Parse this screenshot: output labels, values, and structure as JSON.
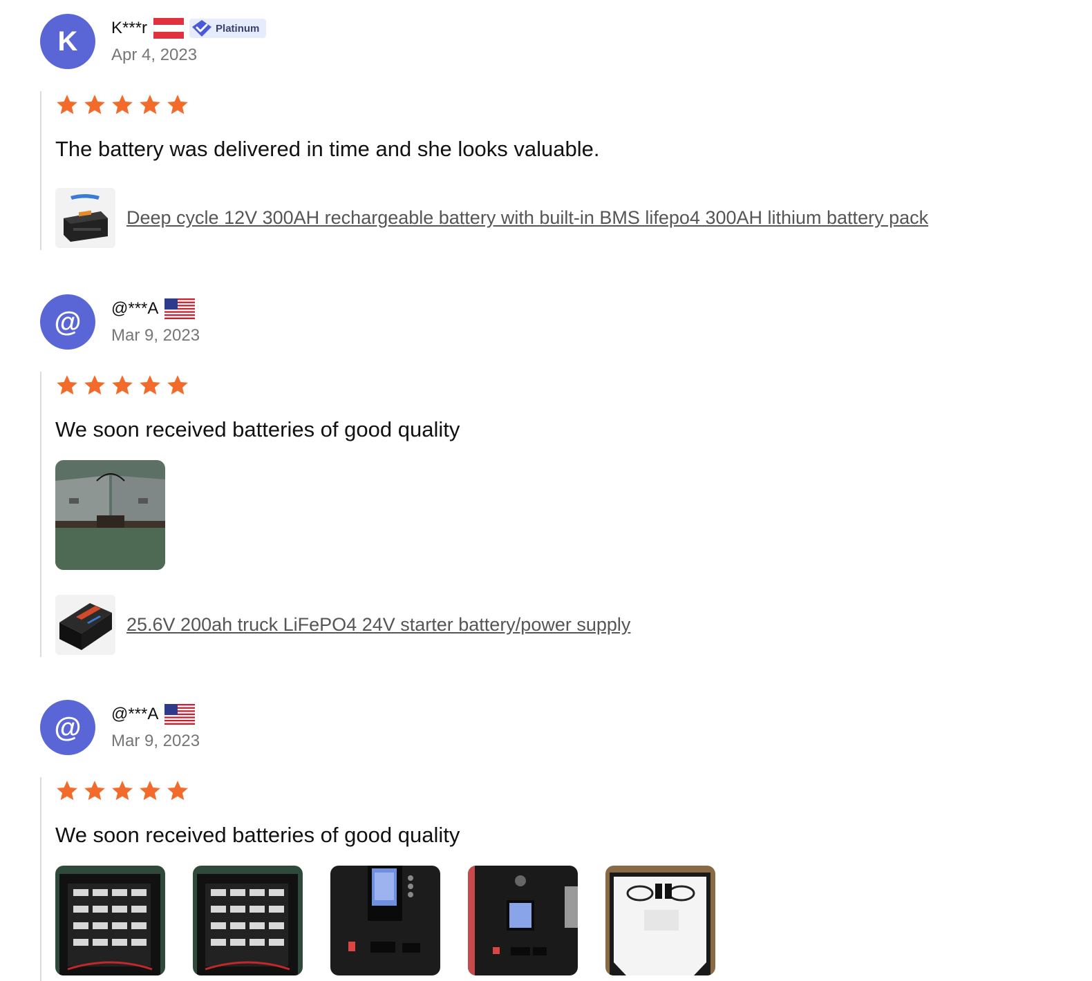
{
  "reviews": [
    {
      "avatar_letter": "K",
      "reviewer_name": "K***r",
      "flag": "austria-flag",
      "badge": "Platinum",
      "date": "Apr 4, 2023",
      "rating": 5,
      "text": "The battery was delivered in time and she looks valuable.",
      "product": "Deep cycle 12V 300AH rechargeable battery with built-in BMS lifepo4 300AH lithium battery pack"
    },
    {
      "avatar_letter": "@",
      "reviewer_name": "@***A",
      "flag": "usa-flag",
      "date": "Mar 9, 2023",
      "rating": 5,
      "text": "We soon received batteries of good quality",
      "product": "25.6V 200ah truck LiFePO4 24V starter battery/power supply"
    },
    {
      "avatar_letter": "@",
      "reviewer_name": "@***A",
      "flag": "usa-flag",
      "date": "Mar 9, 2023",
      "rating": 5,
      "text": "We soon received batteries of good quality"
    }
  ],
  "colors": {
    "avatar": "#5b66d6",
    "star": "#f26b2a",
    "date": "#767676",
    "link": "#555555"
  }
}
